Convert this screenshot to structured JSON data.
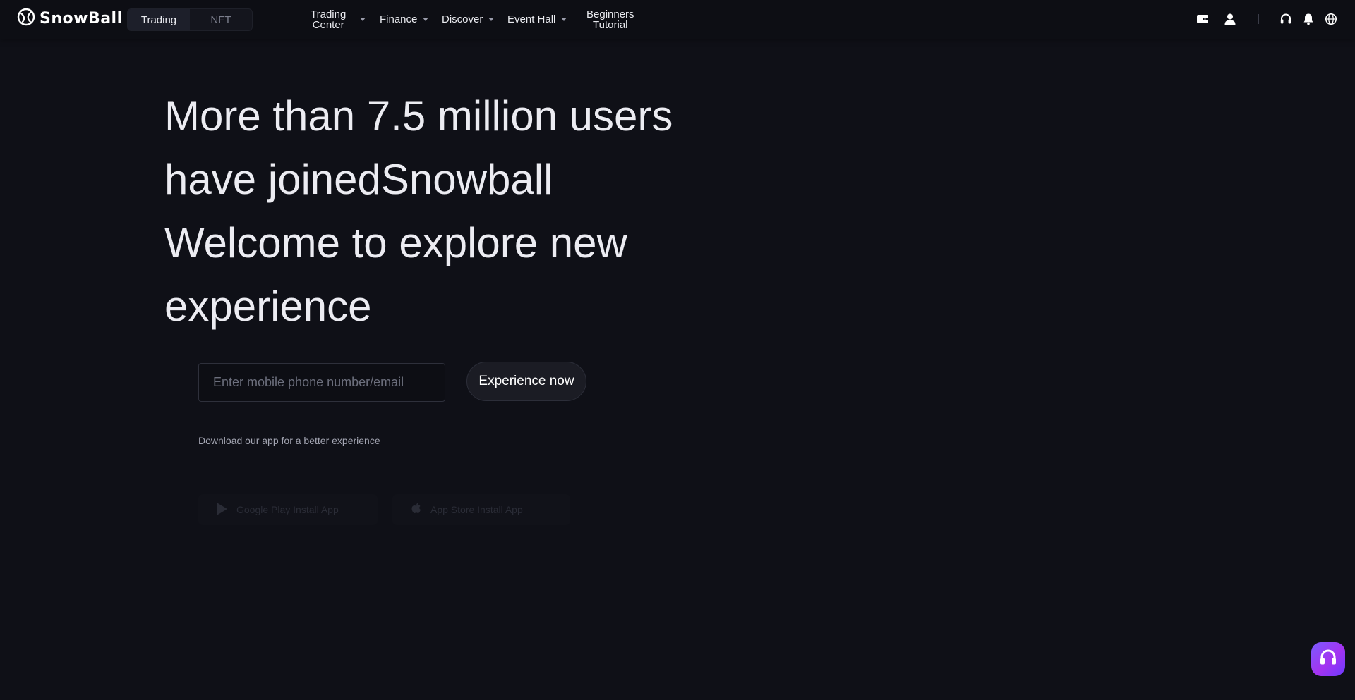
{
  "brand": {
    "name": "SnowBall"
  },
  "mode_switch": {
    "items": [
      "Trading",
      "NFT"
    ],
    "active": "Trading"
  },
  "nav": {
    "trading_center": {
      "line1": "Trading",
      "line2": "Center"
    },
    "finance": "Finance",
    "discover": "Discover",
    "event_hall": "Event Hall",
    "beginners_tutorial": {
      "line1": "Beginners",
      "line2": "Tutorial"
    }
  },
  "header_icons": [
    "wallet-icon",
    "user-icon",
    "headset-icon",
    "bell-icon",
    "globe-icon"
  ],
  "hero": {
    "line1": "More than 7.5 million users",
    "line2": "have joinedSnowball",
    "line3": "Welcome to explore new",
    "line4": "experience"
  },
  "signup": {
    "placeholder": "Enter mobile phone number/email",
    "value": "",
    "button_label": "Experience now"
  },
  "download": {
    "note": "Download our app for a better experience",
    "google_play": "Google Play Install App",
    "app_store": "App Store Install App"
  },
  "support_fab": {
    "icon": "headset-icon"
  },
  "colors": {
    "background": "#0f1017",
    "header": "#0d0e14",
    "text": "#e8e9ee",
    "muted": "#7b7e8c",
    "fab_gradient_start": "#7a5cff",
    "fab_gradient_end": "#a433f0"
  }
}
